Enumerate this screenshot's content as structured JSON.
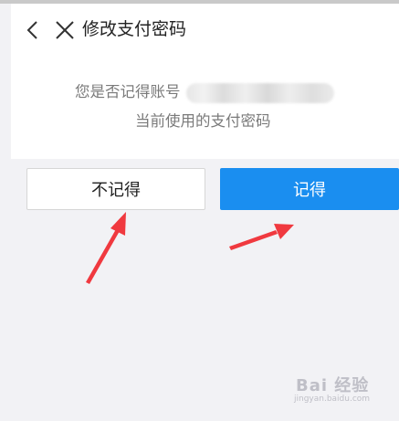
{
  "header": {
    "title": "修改支付密码",
    "back_icon": "chevron-left-icon",
    "close_icon": "close-icon"
  },
  "prompt": {
    "question": "您是否记得账号",
    "account_masked": true,
    "subline": "当前使用的支付密码"
  },
  "buttons": {
    "not_remember": "不记得",
    "remember": "记得"
  },
  "colors": {
    "primary": "#1a8ef0",
    "annotation_arrow": "#f0393f",
    "background": "#f2f2f5"
  },
  "watermark": {
    "logo": "Bai 经验",
    "url": "jingyan.baidu.com"
  }
}
